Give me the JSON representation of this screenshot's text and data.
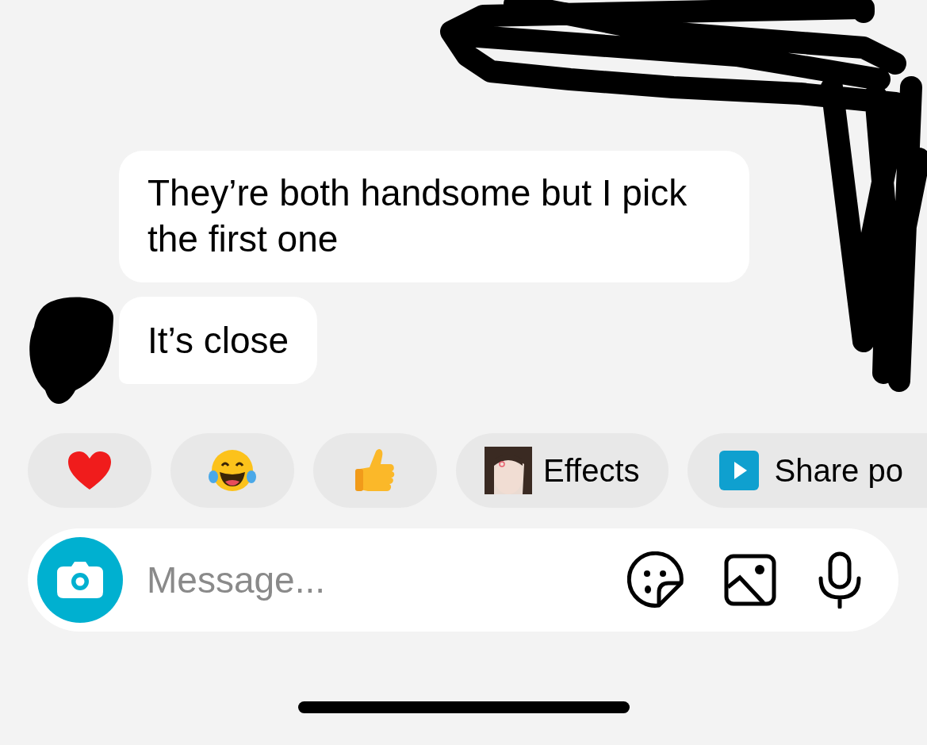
{
  "messages": [
    {
      "text": "They’re both handsome but I pick the first one"
    },
    {
      "text": "It’s close"
    }
  ],
  "quick_replies": [
    {
      "kind": "heart"
    },
    {
      "kind": "laughing"
    },
    {
      "kind": "thumbs_up"
    },
    {
      "kind": "effects",
      "label": "Effects"
    },
    {
      "kind": "share",
      "label": "Share po"
    }
  ],
  "composer": {
    "placeholder": "Message..."
  }
}
